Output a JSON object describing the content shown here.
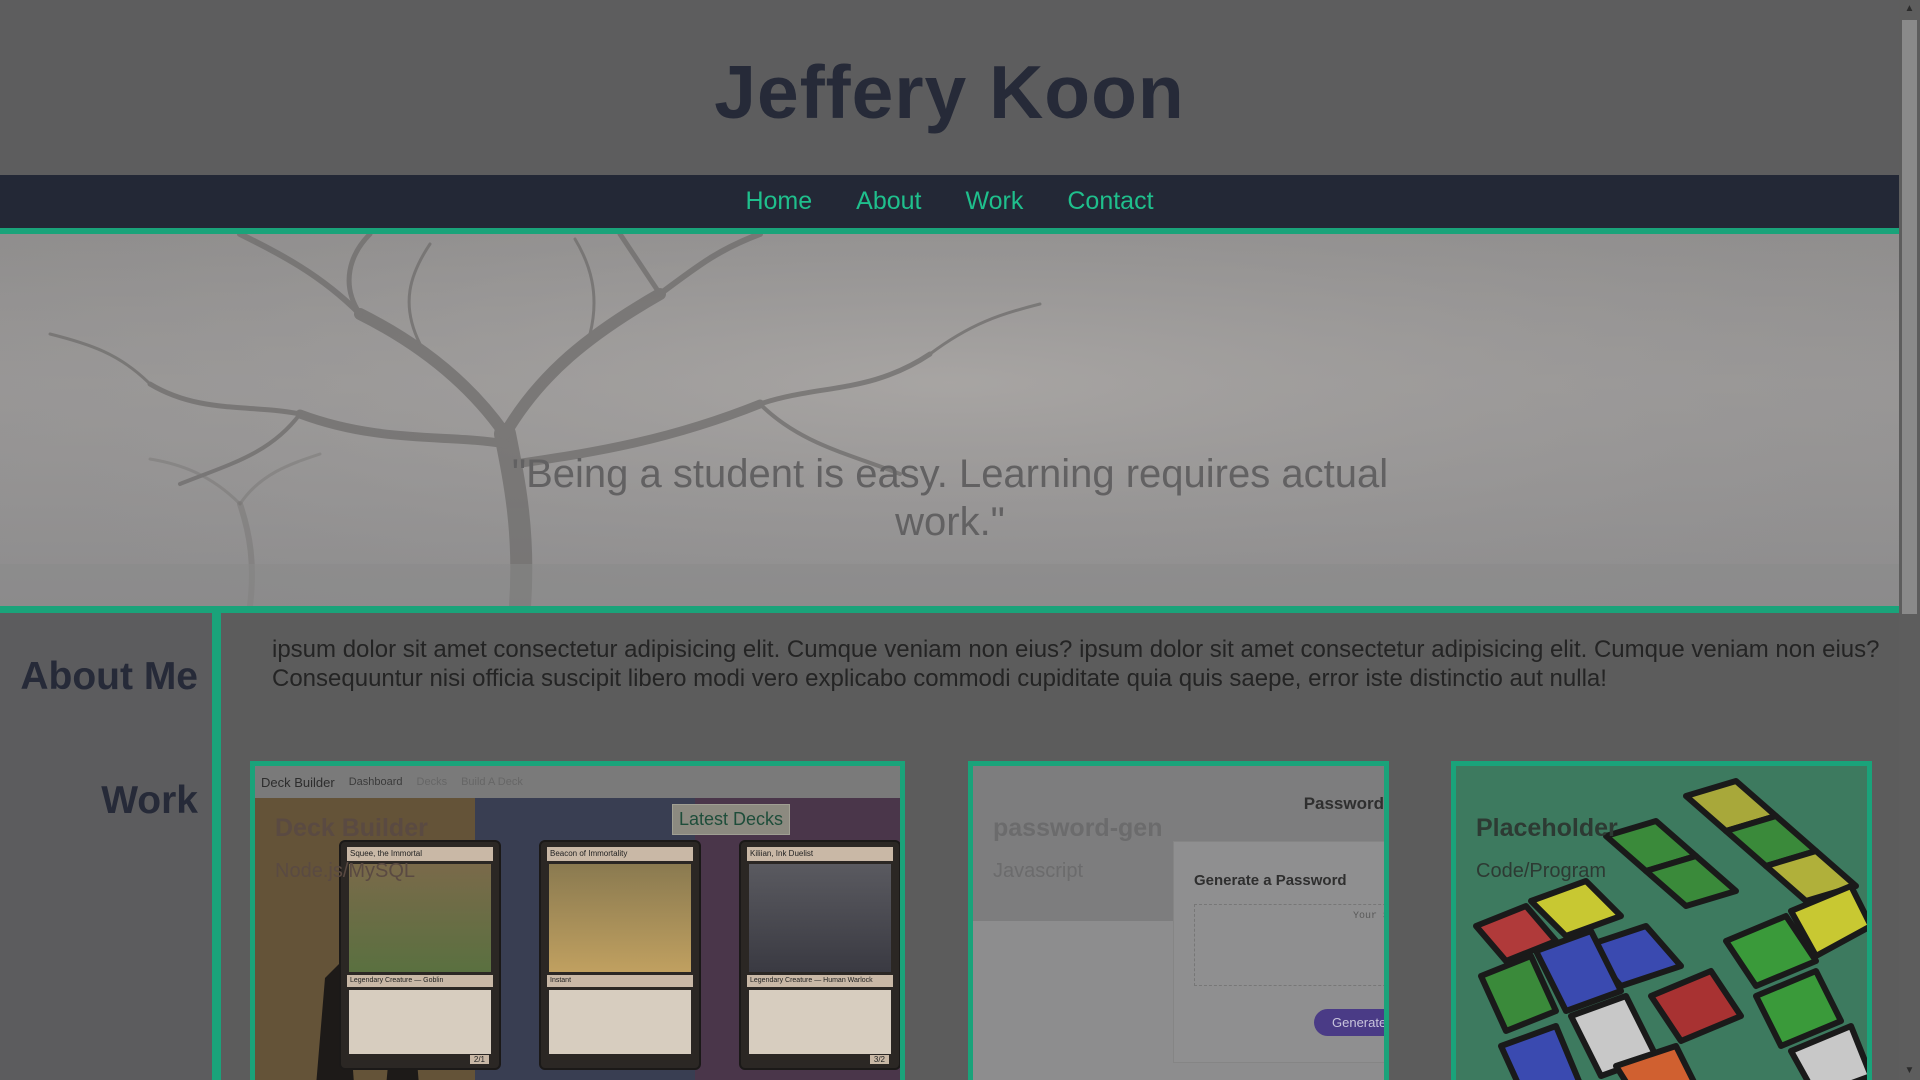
{
  "header": {
    "title": "Jeffery Koon"
  },
  "nav": {
    "items": [
      "Home",
      "About",
      "Work",
      "Contact"
    ]
  },
  "hero": {
    "quote": "\"Being a student is easy. Learning requires actual work.\""
  },
  "about": {
    "heading": "About Me",
    "text": "ipsum dolor sit amet consectetur adipisicing elit. Cumque veniam non eius? ipsum dolor sit amet consectetur adipisicing elit. Cumque veniam non eius? Consequuntur nisi officia suscipit libero modi vero explicabo commodi cupiditate quia quis saepe, error iste distinctio aut nulla!"
  },
  "work": {
    "heading": "Work",
    "cards": [
      {
        "title": "Deck Builder",
        "subtitle": "Node.js/MySQL",
        "screenshot": {
          "brand": "Deck Builder",
          "tabs": [
            "Dashboard",
            "Decks",
            "Build A Deck"
          ],
          "banner": "Latest Decks",
          "mtg_cards": [
            {
              "name": "Squee, the Immortal",
              "type": "Legendary Creature — Goblin",
              "pt": "2/1"
            },
            {
              "name": "Beacon of Immortality",
              "type": "Instant",
              "pt": ""
            },
            {
              "name": "Kiliian, Ink Duelist",
              "type": "Legendary Creature — Human Warlock",
              "pt": "3/2"
            }
          ]
        }
      },
      {
        "title": "password-gen",
        "subtitle": "Javascript",
        "screenshot": {
          "header": "Password",
          "label": "Generate a Password",
          "placeholder": "Your Secu",
          "button": "Generate"
        }
      },
      {
        "title": "Placeholder",
        "subtitle": "Code/Program"
      }
    ]
  },
  "colors": {
    "accent": "#1aa37a",
    "nav_bg": "#232836",
    "nav_link": "#1fbf8c",
    "heading": "#262a38"
  }
}
